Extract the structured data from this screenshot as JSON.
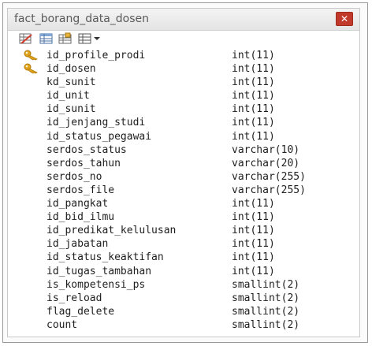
{
  "window": {
    "title": "fact_borang_data_dosen",
    "close_label": "✕"
  },
  "toolbar": {
    "icons": [
      "design-table-icon",
      "table-properties-icon",
      "table-data-icon",
      "table-view-dropdown-icon"
    ]
  },
  "colors": {
    "close_bg": "#c0392b",
    "key_icon": "#e0a21a",
    "text": "#1e1e1e"
  },
  "fields": [
    {
      "name": "id_profile_prodi",
      "type": "int(11)",
      "primary_key": true
    },
    {
      "name": "id_dosen",
      "type": "int(11)",
      "primary_key": true
    },
    {
      "name": "kd_sunit",
      "type": "int(11)",
      "primary_key": false
    },
    {
      "name": "id_unit",
      "type": "int(11)",
      "primary_key": false
    },
    {
      "name": "id_sunit",
      "type": "int(11)",
      "primary_key": false
    },
    {
      "name": "id_jenjang_studi",
      "type": "int(11)",
      "primary_key": false
    },
    {
      "name": "id_status_pegawai",
      "type": "int(11)",
      "primary_key": false
    },
    {
      "name": "serdos_status",
      "type": "varchar(10)",
      "primary_key": false
    },
    {
      "name": "serdos_tahun",
      "type": "varchar(20)",
      "primary_key": false
    },
    {
      "name": "serdos_no",
      "type": "varchar(255)",
      "primary_key": false
    },
    {
      "name": "serdos_file",
      "type": "varchar(255)",
      "primary_key": false
    },
    {
      "name": "id_pangkat",
      "type": "int(11)",
      "primary_key": false
    },
    {
      "name": "id_bid_ilmu",
      "type": "int(11)",
      "primary_key": false
    },
    {
      "name": "id_predikat_kelulusan",
      "type": "int(11)",
      "primary_key": false
    },
    {
      "name": "id_jabatan",
      "type": "int(11)",
      "primary_key": false
    },
    {
      "name": "id_status_keaktifan",
      "type": "int(11)",
      "primary_key": false
    },
    {
      "name": "id_tugas_tambahan",
      "type": "int(11)",
      "primary_key": false
    },
    {
      "name": "is_kompetensi_ps",
      "type": "smallint(2)",
      "primary_key": false
    },
    {
      "name": "is_reload",
      "type": "smallint(2)",
      "primary_key": false
    },
    {
      "name": "flag_delete",
      "type": "smallint(2)",
      "primary_key": false
    },
    {
      "name": "count",
      "type": "smallint(2)",
      "primary_key": false
    }
  ]
}
